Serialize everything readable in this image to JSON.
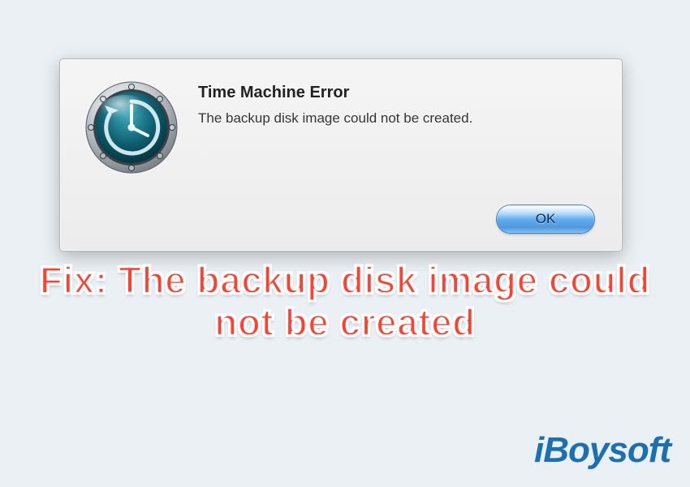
{
  "dialog": {
    "title": "Time Machine Error",
    "message": "The backup disk image could not be created.",
    "ok_label": "OK",
    "icon_name": "time-machine-icon"
  },
  "caption_text": "Fix: The backup disk image could not be created",
  "brand_name": "iBoysoft",
  "colors": {
    "page_bg": "#eaf0f4",
    "caption": "#ff402f",
    "brand": "#1b6fb3",
    "button_blue": "#5aa9ec"
  }
}
